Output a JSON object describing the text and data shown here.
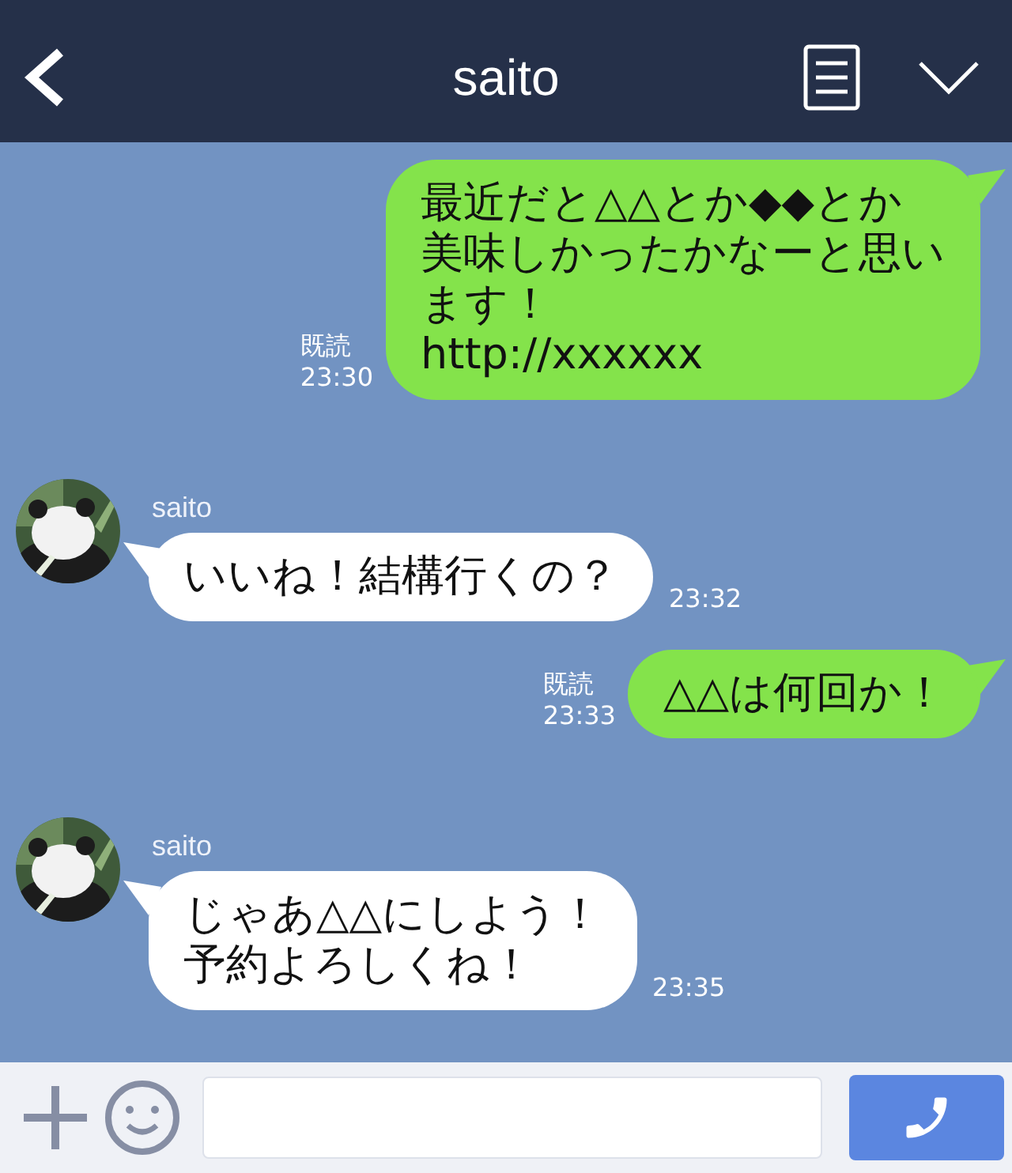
{
  "header": {
    "title": "saito"
  },
  "messages": [
    {
      "kind": "sent",
      "lines": [
        "最近だと△△とか◆◆とか",
        "美味しかったかなーと思い",
        "ます！",
        "http://xxxxxx"
      ],
      "read": "既読",
      "time": "23:30"
    },
    {
      "kind": "received",
      "name": "saito",
      "lines": [
        "いいね！結構行くの？"
      ],
      "time": "23:32"
    },
    {
      "kind": "sent",
      "lines": [
        "△△は何回か！"
      ],
      "read": "既読",
      "time": "23:33"
    },
    {
      "kind": "received",
      "name": "saito",
      "lines": [
        "じゃあ△△にしよう！",
        "予約よろしくね！"
      ],
      "time": "23:35"
    }
  ]
}
